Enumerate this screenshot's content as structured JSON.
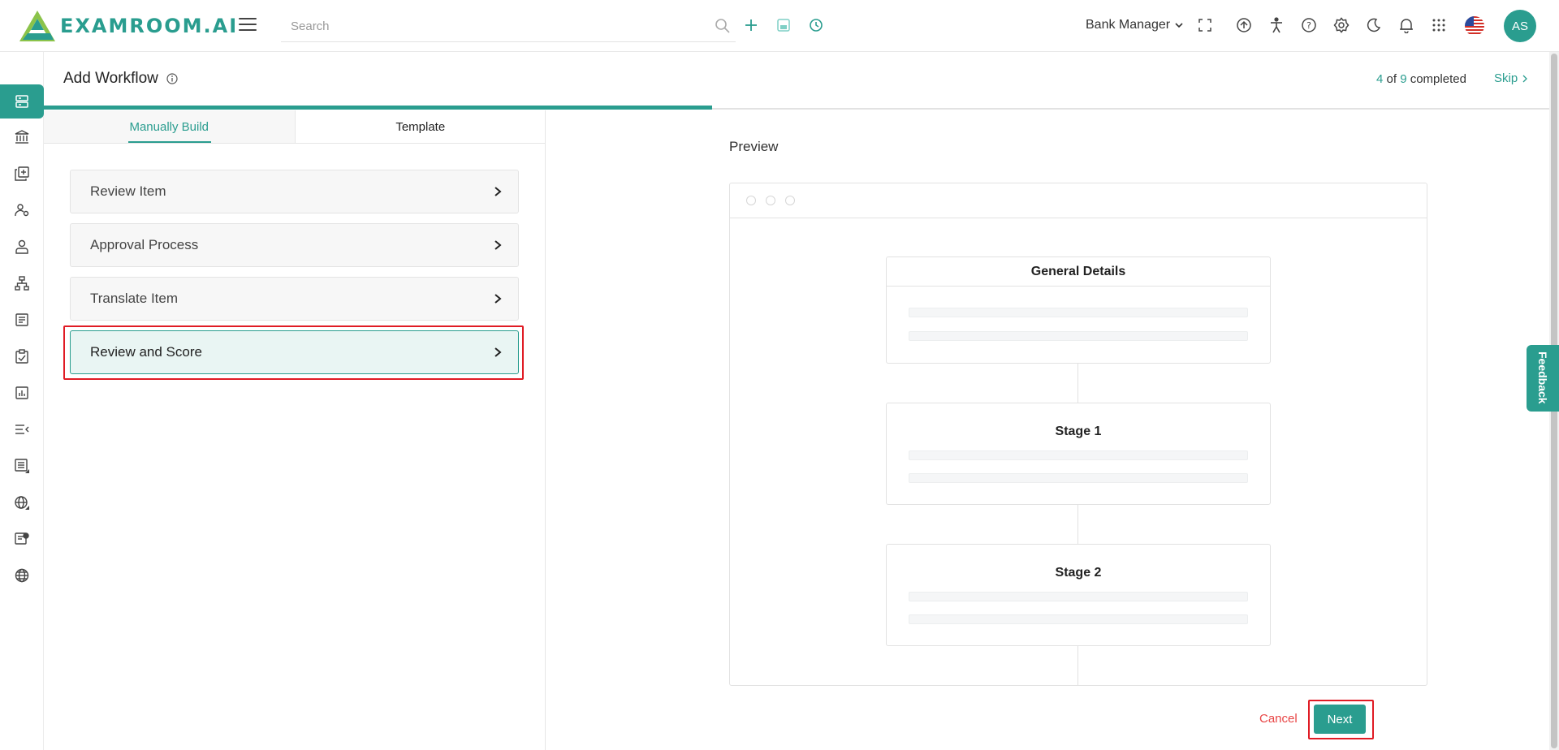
{
  "app": {
    "brand": "EXAMROOM.AI",
    "accent": "#2a9d8f"
  },
  "header": {
    "search_placeholder": "Search",
    "role": "Bank Manager",
    "avatar_initials": "AS"
  },
  "page": {
    "title": "Add Workflow",
    "progress": {
      "current": "4",
      "of_label": "of",
      "total": "9",
      "completed_label": "completed",
      "fraction": 0.444
    },
    "skip_label": "Skip"
  },
  "tabs": [
    {
      "label": "Manually Build",
      "active": true
    },
    {
      "label": "Template",
      "active": false
    }
  ],
  "workflow_items": [
    {
      "label": "Review Item",
      "selected": false
    },
    {
      "label": "Approval Process",
      "selected": false
    },
    {
      "label": "Translate Item",
      "selected": false
    },
    {
      "label": "Review and Score",
      "selected": true
    }
  ],
  "preview": {
    "label": "Preview",
    "cards": [
      {
        "title": "General Details"
      },
      {
        "title": "Stage 1"
      },
      {
        "title": "Stage 2"
      }
    ]
  },
  "actions": {
    "cancel_label": "Cancel",
    "next_label": "Next"
  },
  "feedback_label": "Feedback"
}
